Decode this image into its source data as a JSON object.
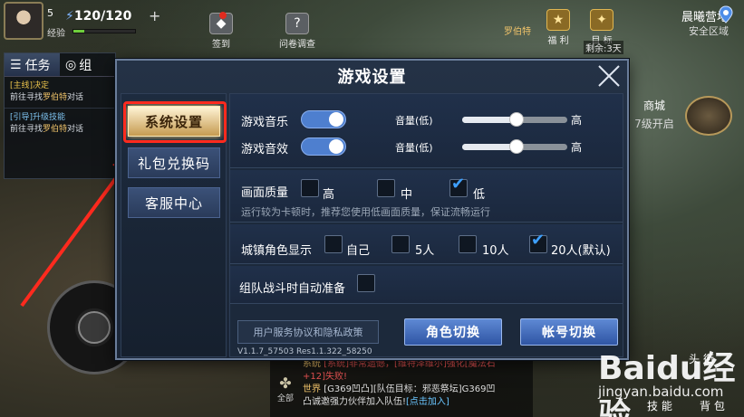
{
  "hud": {
    "level": "5",
    "hp": "120/120",
    "plus": "+",
    "exp_label": "经验",
    "exp_progress": 0.18,
    "top_buttons": [
      "签到",
      "问卷调查"
    ],
    "npc_name": "罗伯特",
    "gold_buttons": [
      "福 利",
      "目 标"
    ],
    "remaining": "剩余:3天",
    "location": "晨曦营地",
    "zone": "安全区域"
  },
  "quest": {
    "tab_task": "任务",
    "tab_team": "组",
    "items": [
      {
        "tag": "[主线]决定",
        "line": "前往寻找",
        "npc": "罗伯特",
        "suffix": "对话"
      },
      {
        "tag": "[引导]升级技能",
        "line": "前往寻找",
        "npc": "罗伯特",
        "suffix": "对话"
      }
    ]
  },
  "right": {
    "shop": "商城",
    "shop_unlock": "7级开启",
    "skill1": "头 衔",
    "skill2": "技 能",
    "skill3": "背 包"
  },
  "chat": {
    "line1_channel": "系统",
    "line1_text": "[系统]非常遗憾，[维特泽维尔]强化[魔法石",
    "line2_text": "+12]失败!",
    "line3_channel": "世界",
    "line3_text": "[G369凹凸][队伍目标：邪恶祭坛]G369凹",
    "line4_text": "凸诚邀强力伙伴加入队伍!",
    "line4_link": "[点击加入]",
    "all": "全部"
  },
  "dialog": {
    "title": "游戏设置",
    "sidebar": [
      "系统设置",
      "礼包兑换码",
      "客服中心"
    ],
    "music_label": "游戏音乐",
    "sfx_label": "游戏音效",
    "volume_label": "音量(低)",
    "high": "高",
    "music_volume": 0.52,
    "sfx_volume": 0.52,
    "quality_label": "画面质量",
    "quality_options": [
      "高",
      "中",
      "低"
    ],
    "quality_hint": "运行较为卡顿时，推荐您使用低画面质量，保证流畅运行",
    "display_label": "城镇角色显示",
    "display_options": [
      "自己",
      "5人",
      "10人",
      "20人(默认)"
    ],
    "auto_ready_label": "组队战斗时自动准备",
    "policy_button": "用户服务协议和隐私政策",
    "switch_role": "角色切换",
    "switch_account": "帐号切换",
    "version": "V1.1.7_57503 Res1.1.322_58250"
  },
  "watermark": {
    "brand": "Baidu经验",
    "url": "jingyan.baidu.com"
  }
}
